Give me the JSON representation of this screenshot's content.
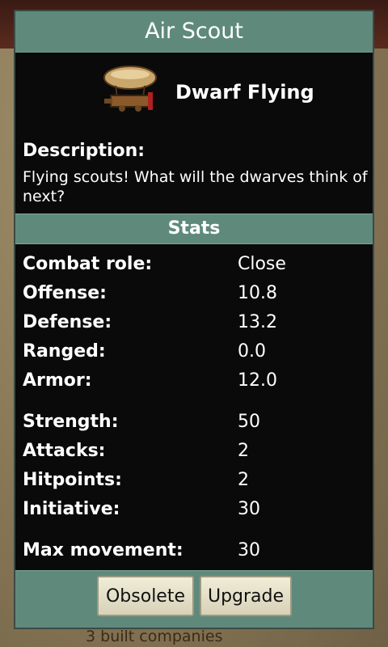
{
  "background": {
    "close_glyph": "✕",
    "peek_text": "3 built companies"
  },
  "dialog": {
    "title": "Air Scout",
    "unit_type": "Dwarf Flying",
    "unit_icon": "airship-icon",
    "description_label": "Description:",
    "description_text": "Flying scouts! What will the dwarves think of next?",
    "stats_header": "Stats",
    "stats": [
      {
        "label": "Combat role:",
        "value": "Close"
      },
      {
        "label": "Offense:",
        "value": "10.8"
      },
      {
        "label": "Defense:",
        "value": "13.2"
      },
      {
        "label": "Ranged:",
        "value": "0.0"
      },
      {
        "label": "Armor:",
        "value": "12.0"
      },
      {
        "label": "Strength:",
        "value": "50"
      },
      {
        "label": "Attacks:",
        "value": "2"
      },
      {
        "label": "Hitpoints:",
        "value": "2"
      },
      {
        "label": "Initiative:",
        "value": "30"
      },
      {
        "label": "Max movement:",
        "value": "30"
      }
    ],
    "buttons": {
      "obsolete": "Obsolete",
      "upgrade": "Upgrade"
    }
  },
  "colors": {
    "teal_bar": "#5f8a7b",
    "dialog_bg": "#0a0a0a",
    "close_red": "#9c1d1d"
  }
}
